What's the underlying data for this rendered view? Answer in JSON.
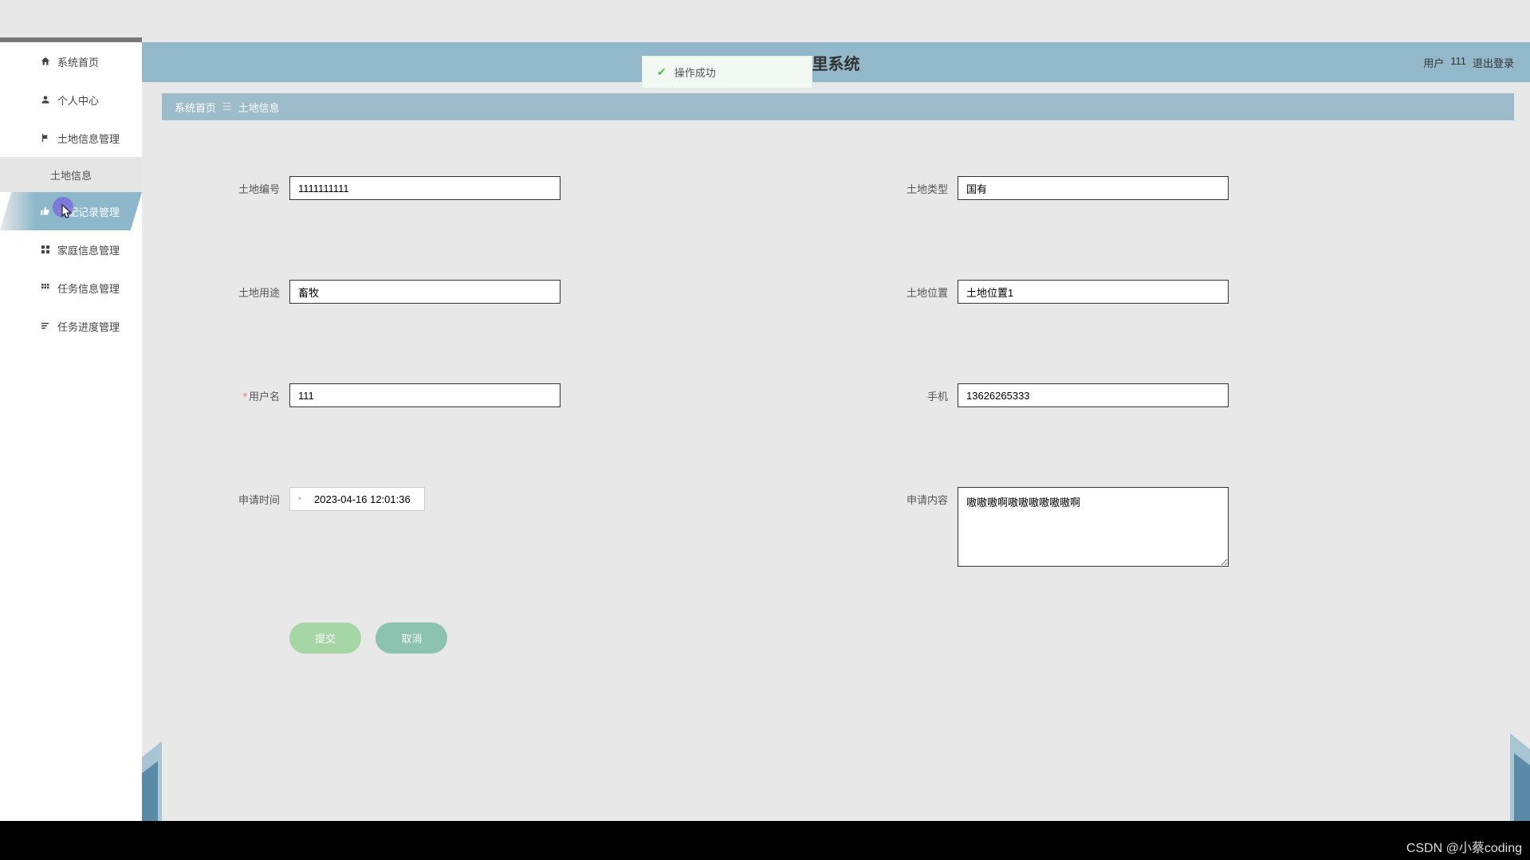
{
  "header": {
    "title_suffix": "里系统",
    "user_prefix": "用户",
    "username": "111",
    "logout": "退出登录"
  },
  "sidebar": {
    "items": [
      {
        "label": "系统首页",
        "icon": "home"
      },
      {
        "label": "个人中心",
        "icon": "person"
      },
      {
        "label": "土地信息管理",
        "icon": "flag"
      },
      {
        "label": "土地信息"
      },
      {
        "label": "分配记录管理",
        "icon": "thumb"
      },
      {
        "label": "家庭信息管理",
        "icon": "grid"
      },
      {
        "label": "任务信息管理",
        "icon": "grid2"
      },
      {
        "label": "任务进度管理",
        "icon": "list"
      }
    ]
  },
  "breadcrumb": {
    "home": "系统首页",
    "current": "土地信息"
  },
  "toast": {
    "message": "操作成功"
  },
  "form": {
    "labels": {
      "land_id": "土地编号",
      "land_type": "土地类型",
      "land_use": "土地用途",
      "land_location": "土地位置",
      "username": "用户名",
      "phone": "手机",
      "apply_time": "申请时间",
      "apply_content": "申请内容"
    },
    "values": {
      "land_id": "1111111111",
      "land_type": "国有",
      "land_use": "畜牧",
      "land_location": "土地位置1",
      "username": "111",
      "phone": "13626265333",
      "apply_time": "2023-04-16 12:01:36",
      "apply_content": "嗷嗷嗷啊嗷嗷嗷嗷嗷嗷啊"
    },
    "buttons": {
      "submit": "提交",
      "cancel": "取消"
    }
  },
  "watermark": "CSDN @小蔡coding"
}
